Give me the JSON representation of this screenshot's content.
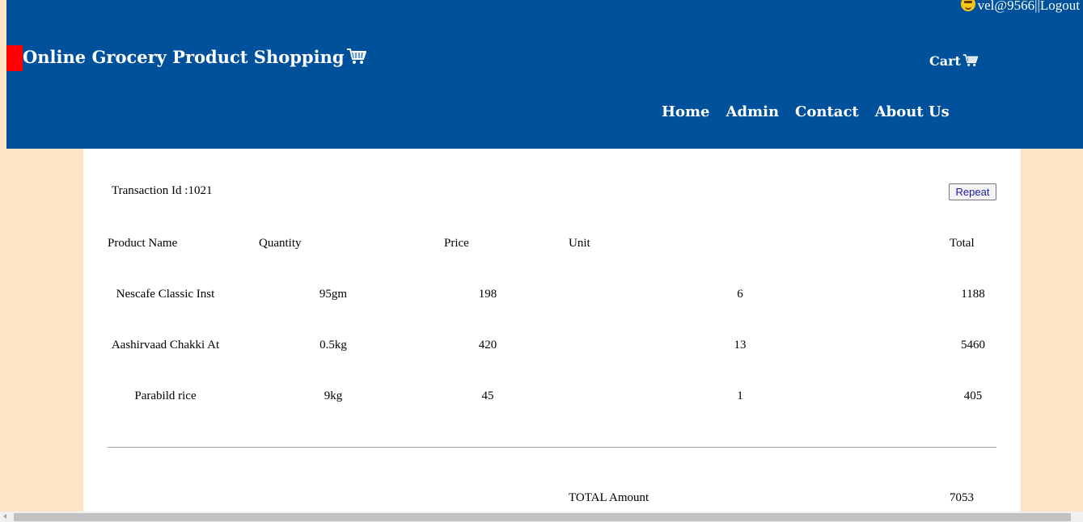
{
  "header": {
    "user": "vel@9566",
    "separator": "||",
    "logout_label": "Logout",
    "site_title": "Online Grocery Product Shopping",
    "cart_label": "Cart",
    "nav": [
      "Home",
      "Admin",
      "Contact",
      "About Us"
    ],
    "bg_color": "#00519b",
    "marker_color": "#ff0000"
  },
  "transaction": {
    "label": "Transaction Id :1021",
    "repeat_label": "Repeat"
  },
  "table": {
    "columns": [
      "Product Name",
      "Quantity",
      "Price",
      "Unit",
      "Total"
    ],
    "rows": [
      {
        "name": "Nescafe Classic Inst",
        "quantity": "95gm",
        "price": "198",
        "unit": "6",
        "total": "1188"
      },
      {
        "name": "Aashirvaad Chakki At",
        "quantity": "0.5kg",
        "price": "420",
        "unit": "13",
        "total": "5460"
      },
      {
        "name": "Parabild rice",
        "quantity": "9kg",
        "price": "45",
        "unit": "1",
        "total": "405"
      }
    ]
  },
  "summary": {
    "total_label": "TOTAL Amount",
    "total_value": "7053"
  },
  "icons": {
    "user": "smiley-icon",
    "cart": "cart-icon"
  },
  "colors": {
    "page_bg": "#ffe4c4",
    "panel_bg": "#ffffff",
    "button_text": "#1a1aa6"
  }
}
